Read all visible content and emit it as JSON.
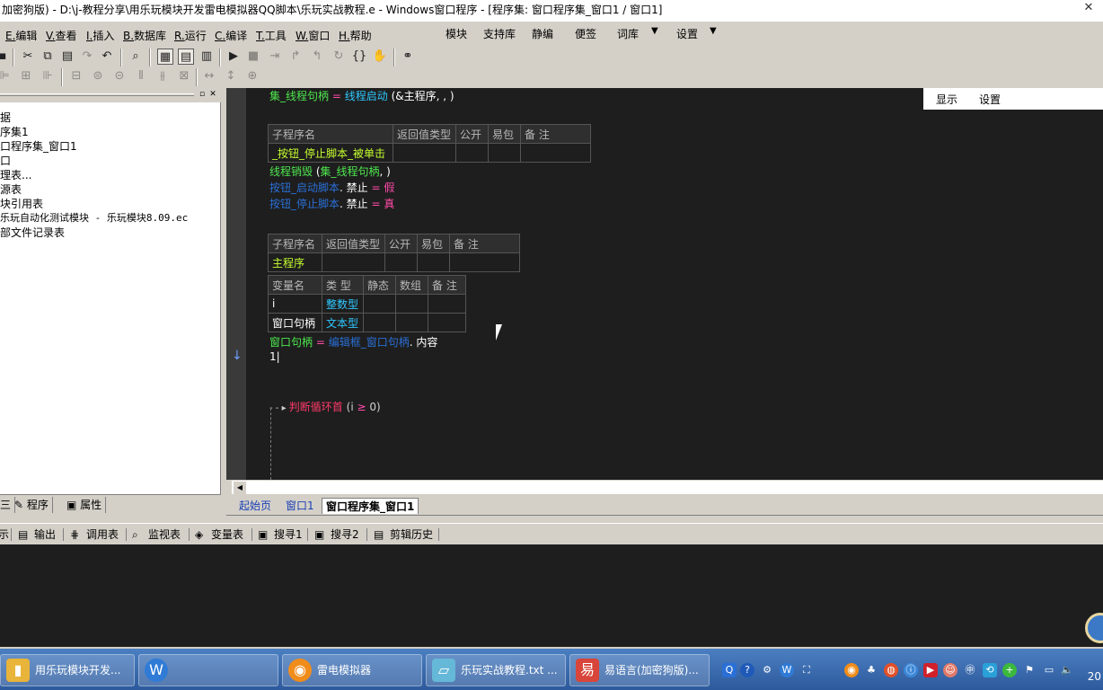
{
  "window": {
    "title": "加密狗版) - D:\\j-教程分享\\用乐玩模块开发雷电模拟器QQ脚本\\乐玩实战教程.e - Windows窗口程序 - [程序集: 窗口程序集_窗口1 / 窗口1]",
    "close_glyph": "✕"
  },
  "menu": {
    "items": [
      {
        "key": "E.",
        "label": "编辑"
      },
      {
        "key": "V.",
        "label": "查看"
      },
      {
        "key": "I.",
        "label": "插入"
      },
      {
        "key": "B.",
        "label": "数据库"
      },
      {
        "key": "R.",
        "label": "运行"
      },
      {
        "key": "C.",
        "label": "编译"
      },
      {
        "key": "T.",
        "label": "工具"
      },
      {
        "key": "W.",
        "label": "窗口"
      },
      {
        "key": "H.",
        "label": "帮助"
      }
    ],
    "right_items": [
      "模块",
      "支持库",
      "静编",
      "便签",
      "词库",
      "设置"
    ]
  },
  "left_panel": {
    "tree": [
      "据",
      "序集1",
      "口程序集_窗口1",
      "口",
      "理表...",
      "源表",
      "块引用表",
      " 乐玩自动化测试模块 - 乐玩模块8.09.ec",
      "部文件记录表"
    ],
    "tabs": [
      "三",
      "程序",
      "属性"
    ]
  },
  "editor": {
    "line1": {
      "var": "集_线程句柄",
      "op": "=",
      "func": "线程启动",
      "args": "(&主程序, , )"
    },
    "sub1": {
      "headers": [
        "子程序名",
        "返回值类型",
        "公开",
        "易包",
        "备 注"
      ],
      "name": "_按钮_停止脚本_被单击"
    },
    "line_destroy": {
      "func": "线程销毁",
      "args_open": "(",
      "arg": "集_线程句柄",
      "args_close": ", )"
    },
    "line_start": {
      "obj": "按钮_启动脚本",
      "prop": ". 禁止",
      "op": "=",
      "val": "假"
    },
    "line_stop": {
      "obj": "按钮_停止脚本",
      "prop": ". 禁止",
      "op": "=",
      "val": "真"
    },
    "sub2": {
      "headers": [
        "子程序名",
        "返回值类型",
        "公开",
        "易包",
        "备 注"
      ],
      "name": "主程序"
    },
    "vars": {
      "headers": [
        "变量名",
        "类 型",
        "静态",
        "数组",
        "备 注"
      ],
      "rows": [
        {
          "name": "i",
          "type": "整数型"
        },
        {
          "name": "窗口句柄",
          "type": "文本型"
        }
      ]
    },
    "line_assign": {
      "var": "窗口句柄",
      "op": "=",
      "obj": "编辑框_窗口句柄",
      "prop": ". 内容"
    },
    "line_cursor": "1",
    "line_loop": {
      "kw": "判断循环首",
      "open": "(",
      "var": "i",
      "op": "≥",
      "num": "0",
      "close": ")"
    }
  },
  "popup": {
    "show": "显示",
    "settings": "设置"
  },
  "doc_tabs": [
    "起始页",
    "窗口1",
    "窗口程序集_窗口1"
  ],
  "bottom_tabs": [
    "示",
    "输出",
    "调用表",
    "监视表",
    "变量表",
    "搜寻1",
    "搜寻2",
    "剪辑历史"
  ],
  "taskbar": {
    "tasks": [
      {
        "label": "用乐玩模块开发...",
        "color": "#e8b43a"
      },
      {
        "label": "",
        "color": "#2f7bd6"
      },
      {
        "label": "雷电模拟器",
        "color": "#f08c1a"
      },
      {
        "label": "乐玩实战教程.txt ...",
        "color": "#66b8d8"
      },
      {
        "label": "易语言(加密狗版)...",
        "color": "#d8453a"
      }
    ],
    "clock": "20"
  },
  "colors": {
    "editor_bg": "#1e1e1e",
    "accent_green": "#4ee84e",
    "accent_cyan": "#2fc8ff",
    "keyword_pink": "#ff4aa8"
  }
}
